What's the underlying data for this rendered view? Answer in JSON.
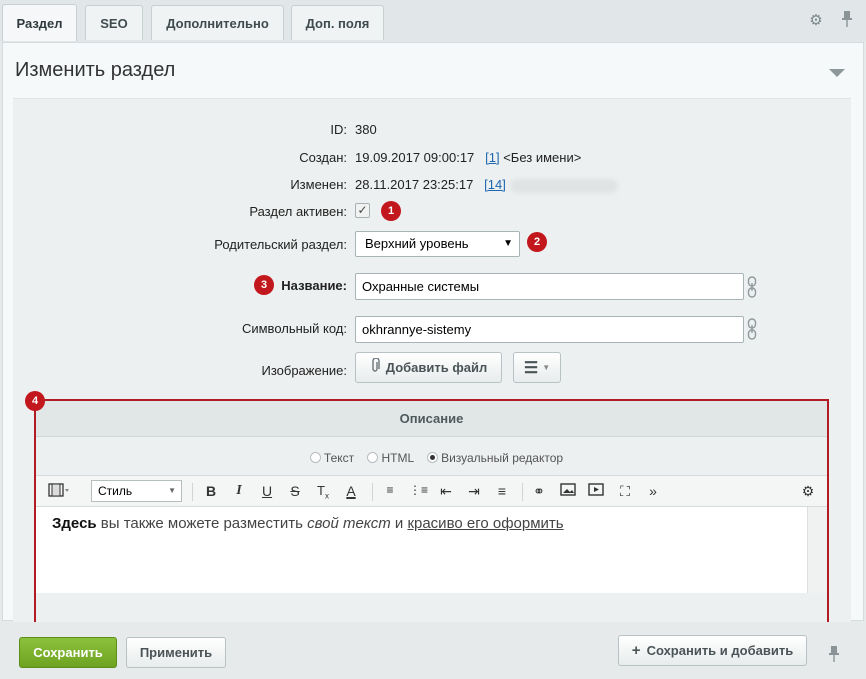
{
  "tabs": [
    {
      "label": "Раздел"
    },
    {
      "label": "SEO"
    },
    {
      "label": "Дополнительно"
    },
    {
      "label": "Доп. поля"
    }
  ],
  "panel": {
    "title": "Изменить раздел"
  },
  "form": {
    "id_label": "ID:",
    "id_value": "380",
    "created_label": "Создан:",
    "created_value": "19.09.2017 09:00:17",
    "created_user_link": "[1]",
    "created_user_name": "<Без имени>",
    "modified_label": "Изменен:",
    "modified_value": "28.11.2017 23:25:17",
    "modified_user_link": "[14]",
    "active_label": "Раздел активен:",
    "active_checked": true,
    "parent_label": "Родительский раздел:",
    "parent_value": "Верхний уровень",
    "name_label": "Название:",
    "name_value": "Охранные системы",
    "code_label": "Символьный код:",
    "code_value": "okhrannye-sistemy",
    "image_label": "Изображение:",
    "add_file_label": "Добавить файл"
  },
  "badges": {
    "b1": "1",
    "b2": "2",
    "b3": "3",
    "b4": "4"
  },
  "editor": {
    "header": "Описание",
    "mode_text": "Текст",
    "mode_html": "HTML",
    "mode_visual": "Визуальный редактор",
    "selected_mode": "Визуальный редактор",
    "style_select": "Стиль",
    "content_bold": "Здесь",
    "content_plain": " вы также можете разместить ",
    "content_italic": "свой текст",
    "content_and": " и ",
    "content_underline": "красиво его оформить"
  },
  "footer": {
    "save_label": "Сохранить",
    "apply_label": "Применить",
    "save_add_label": "Сохранить и добавить"
  },
  "colors": {
    "accent_red": "#c2171c",
    "save_green": "#7ab32e"
  }
}
